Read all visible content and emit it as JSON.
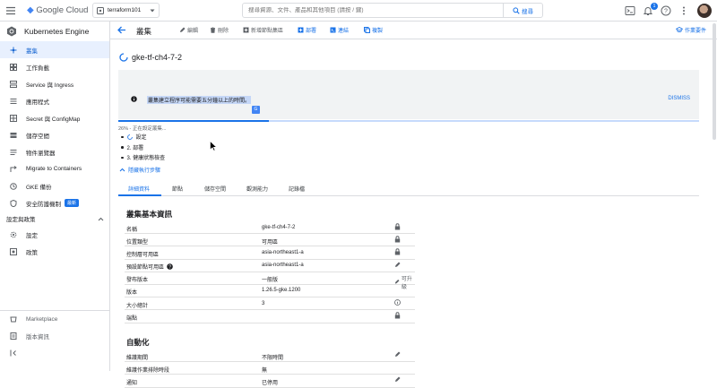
{
  "header": {
    "logo_google": "Google",
    "logo_cloud": "Cloud",
    "project": "terraform101",
    "search_placeholder": "搜尋資源、文件、產品和其他項目 (請按 / 鍵)",
    "search_button": "搜尋",
    "notification_count": "1"
  },
  "sidebar": {
    "title": "Kubernetes Engine",
    "items": [
      {
        "label": "叢集",
        "icon": "hub-icon"
      },
      {
        "label": "工作負載",
        "icon": "workloads-icon"
      },
      {
        "label": "Service 與 Ingress",
        "icon": "network-icon"
      },
      {
        "label": "應用程式",
        "icon": "apps-icon"
      },
      {
        "label": "Secret 與 ConfigMap",
        "icon": "grid-icon"
      },
      {
        "label": "儲存空間",
        "icon": "storage-icon"
      },
      {
        "label": "物件瀏覽器",
        "icon": "list-icon"
      },
      {
        "label": "Migrate to Containers",
        "icon": "migrate-icon"
      },
      {
        "label": "GKE 備份",
        "icon": "backup-icon"
      },
      {
        "label": "安全防護機制",
        "icon": "shield-icon",
        "tag": "最新"
      }
    ],
    "section": "設定與政策",
    "section_items": [
      {
        "label": "設定",
        "icon": "gear-icon"
      },
      {
        "label": "政策",
        "icon": "policy-icon"
      }
    ],
    "bottom": [
      {
        "label": "Marketplace",
        "icon": "marketplace-icon"
      },
      {
        "label": "版本資訊",
        "icon": "release-notes-icon"
      }
    ]
  },
  "toolbar": {
    "title": "叢集",
    "edit": "編輯",
    "delete": "刪除",
    "add_pool": "新增節點集區",
    "deploy": "部署",
    "connect": "連結",
    "duplicate": "複製",
    "tutorial": "作業要件"
  },
  "cluster": {
    "name": "gke-tf-ch4-7-2",
    "banner_message": "叢集建立程序可能需要五分鐘以上的時間。",
    "dismiss": "DISMISS",
    "progress_percent": 26,
    "status": "26% - 正在設定叢集...",
    "steps": [
      "設定",
      "2. 部署",
      "3. 健康狀態檢查"
    ],
    "hide_steps": "隱藏執行步驟"
  },
  "tabs": [
    "詳細資料",
    "節點",
    "儲存空間",
    "觀測能力",
    "記錄檔"
  ],
  "basics": {
    "title": "叢集基本資訊",
    "rows": [
      {
        "k": "名稱",
        "v": "gke-tf-ch4-7-2",
        "icon": "lock-icon"
      },
      {
        "k": "位置類型",
        "v": "可用區",
        "icon": "lock-icon"
      },
      {
        "k": "控制層可用區",
        "v": "asia-northeast1-a",
        "icon": "lock-icon"
      },
      {
        "k": "預設節點可用區",
        "v": "asia-northeast1-a",
        "icon": "pencil-icon",
        "help": true
      },
      {
        "k": "發布版本",
        "v": "一般版",
        "icon": "pencil-icon",
        "action": "可升級"
      },
      {
        "k": "版本",
        "v": "1.26.5-gke.1200",
        "icon": ""
      },
      {
        "k": "大小總計",
        "v": "3",
        "icon": "info-icon"
      },
      {
        "k": "端點",
        "v": "",
        "icon": "lock-icon"
      }
    ]
  },
  "automation": {
    "title": "自動化",
    "rows": [
      {
        "k": "維護期間",
        "v": "不限時間",
        "icon": "pencil-icon"
      },
      {
        "k": "維護作業排除時段",
        "v": "無",
        "icon": ""
      },
      {
        "k": "通知",
        "v": "已停用",
        "icon": "pencil-icon"
      }
    ]
  }
}
